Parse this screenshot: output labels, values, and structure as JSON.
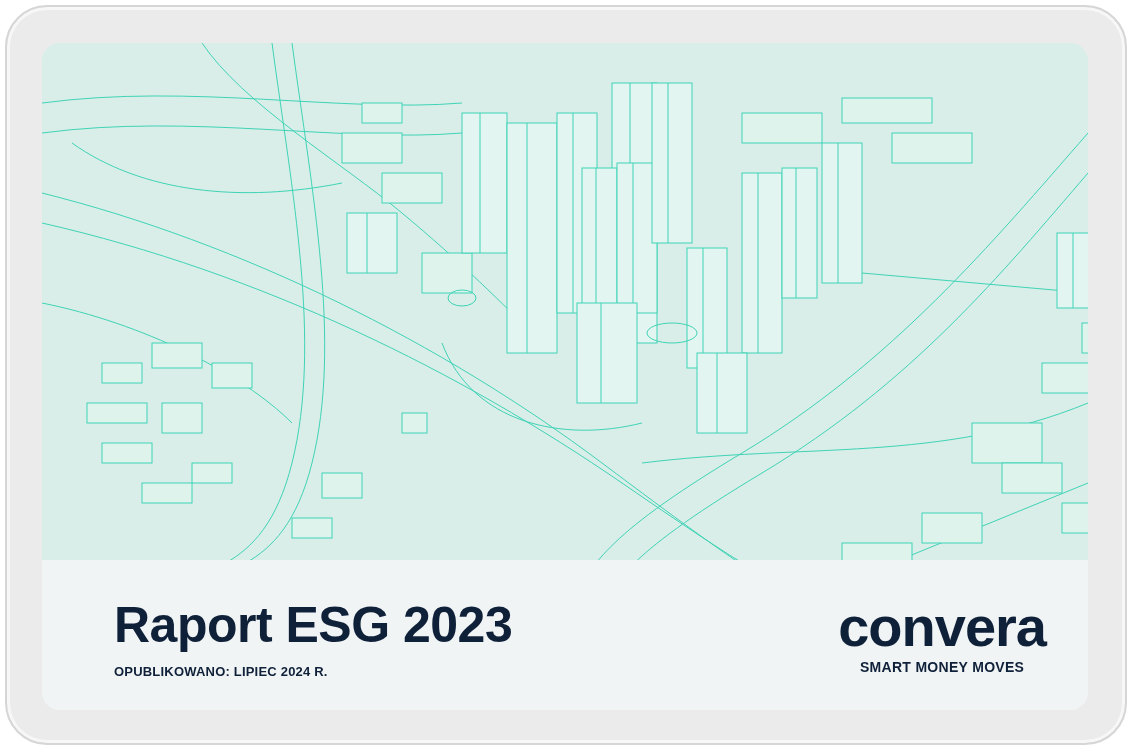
{
  "cover": {
    "title": "Raport ESG 2023",
    "published": "OPUBLIKOWANO: LIPIEC 2024 R.",
    "logo": {
      "wordmark": "convera",
      "tagline": "SMART MONEY MOVES"
    }
  }
}
